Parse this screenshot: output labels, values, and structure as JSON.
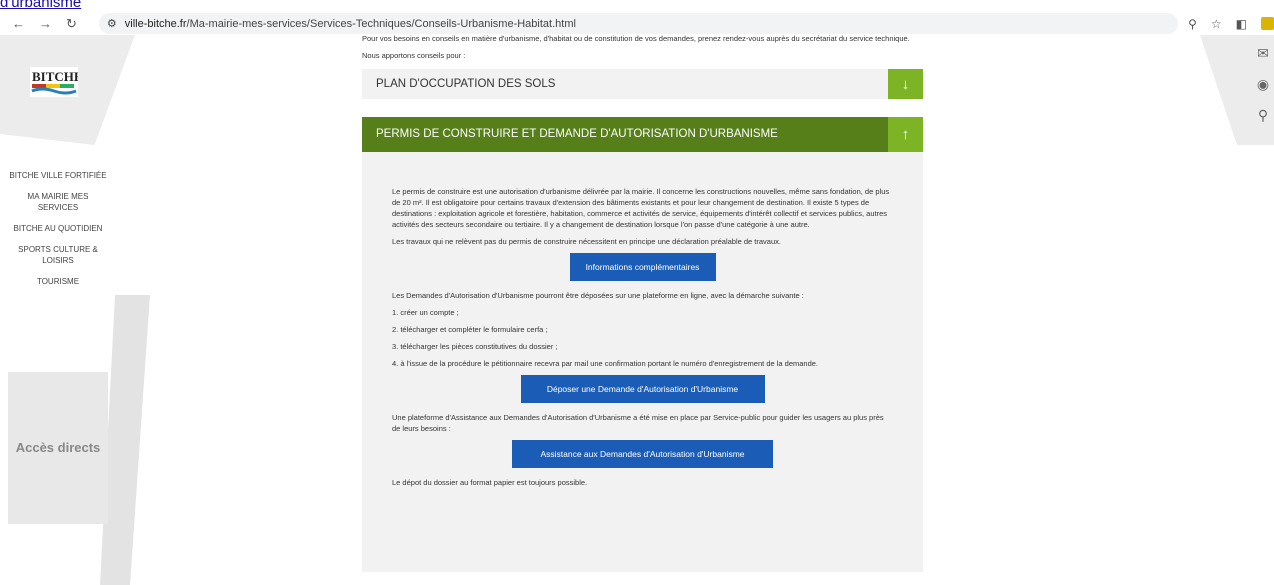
{
  "top_link": "d'urbanisme",
  "browser": {
    "url_site": "ville-bitche.fr",
    "url_path": "/Ma-mairie-mes-services/Services-Techniques/Conseils-Urbanisme-Habitat.html"
  },
  "logo_text": "BITCHE",
  "sidebar": {
    "items": [
      {
        "label": "BITCHE VILLE FORTIFIÉE"
      },
      {
        "label": "MA MAIRIE MES SERVICES"
      },
      {
        "label": "BITCHE AU QUOTIDIEN"
      },
      {
        "label": "SPORTS CULTURE & LOISIRS"
      },
      {
        "label": "TOURISME"
      }
    ],
    "acces_directs": "Accès directs"
  },
  "intro": {
    "text1": "Pour vos besoins en conseils en matière d'urbanisme, d'habitat ou de constitution de vos demandes, prenez rendez-vous auprès du secrétariat du service technique.",
    "text2": "Nous apportons conseils pour :"
  },
  "accordion": {
    "item1_title": "PLAN D'OCCUPATION DES SOLS",
    "item2_title": "PERMIS DE CONSTRUIRE ET DEMANDE D'AUTORISATION D'URBANISME"
  },
  "panel": {
    "p1": "Le permis de construire est une autorisation d'urbanisme délivrée par la mairie. Il concerne les constructions nouvelles, même sans fondation, de plus de 20 m². Il est obligatoire pour certains travaux d'extension des bâtiments existants et pour leur changement de destination. Il existe 5 types de destinations : exploitation agricole et forestière, habitation, commerce et activités de service, équipements d'intérêt collectif et services publics, autres activités des secteurs secondaire ou tertiaire. Il y a changement de destination lorsque l'on passe d'une catégorie à une autre.",
    "p2": "Les travaux qui ne relèvent pas du permis de construire nécessitent en principe une déclaration préalable de travaux.",
    "btn1": "Informations complémentaires",
    "p3": "Les Demandes d'Autorisation d'Urbanisme pourront être déposées sur une plateforme en ligne, avec la démarche suivante :",
    "step1": "1. créer un compte ;",
    "step2": "2. télécharger et compléter le formulaire cerfa ;",
    "step3": "3. télécharger les pièces constitutives du dossier ;",
    "step4": "4. à l'issue de la procédure le pétitionnaire recevra par mail une confirmation portant le numéro d'enregistrement de la demande.",
    "btn2": "Déposer une Demande d'Autorisation d'Urbanisme",
    "p4": "Une plateforme d'Assistance aux Demandes d'Autorisation d'Urbanisme a été mise en place par Service-public pour guider les usagers au plus près de leurs besoins :",
    "btn3": "Assistance aux Demandes d'Autorisation d'Urbanisme",
    "p5": "Le dépot du dossier au format papier est toujours possible."
  },
  "colors": {
    "green_light": "#7cb426",
    "green_dark": "#567f1a",
    "blue_button": "#1b5db6"
  }
}
